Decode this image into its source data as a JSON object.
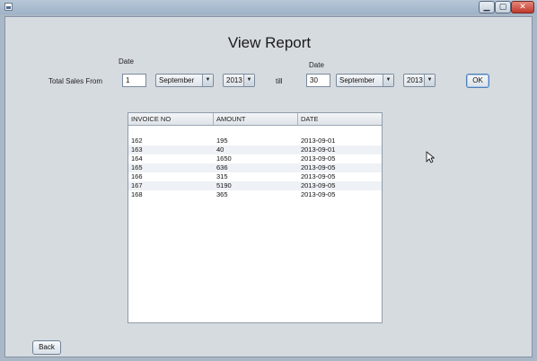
{
  "window": {
    "min_symbol": "▁",
    "max_symbol": "▢",
    "close_symbol": "✕"
  },
  "header": {
    "title": "View Report"
  },
  "form": {
    "from_label": "Total Sales From",
    "date_label_1": "Date",
    "date_label_2": "Date",
    "till_label": "till",
    "from_day": "1",
    "from_month": "September",
    "from_year": "2013",
    "to_day": "30",
    "to_month": "September",
    "to_year": "2013",
    "ok_label": "OK",
    "arrow": "▼"
  },
  "table": {
    "columns": [
      "INVOICE NO",
      "AMOUNT",
      "DATE"
    ],
    "rows": [
      [
        "162",
        "195",
        "2013-09-01"
      ],
      [
        "163",
        "40",
        "2013-09-01"
      ],
      [
        "164",
        "1650",
        "2013-09-05"
      ],
      [
        "165",
        "636",
        "2013-09-05"
      ],
      [
        "166",
        "315",
        "2013-09-05"
      ],
      [
        "167",
        "5190",
        "2013-09-05"
      ],
      [
        "168",
        "365",
        "2013-09-05"
      ]
    ]
  },
  "footer": {
    "back_label": "Back"
  }
}
